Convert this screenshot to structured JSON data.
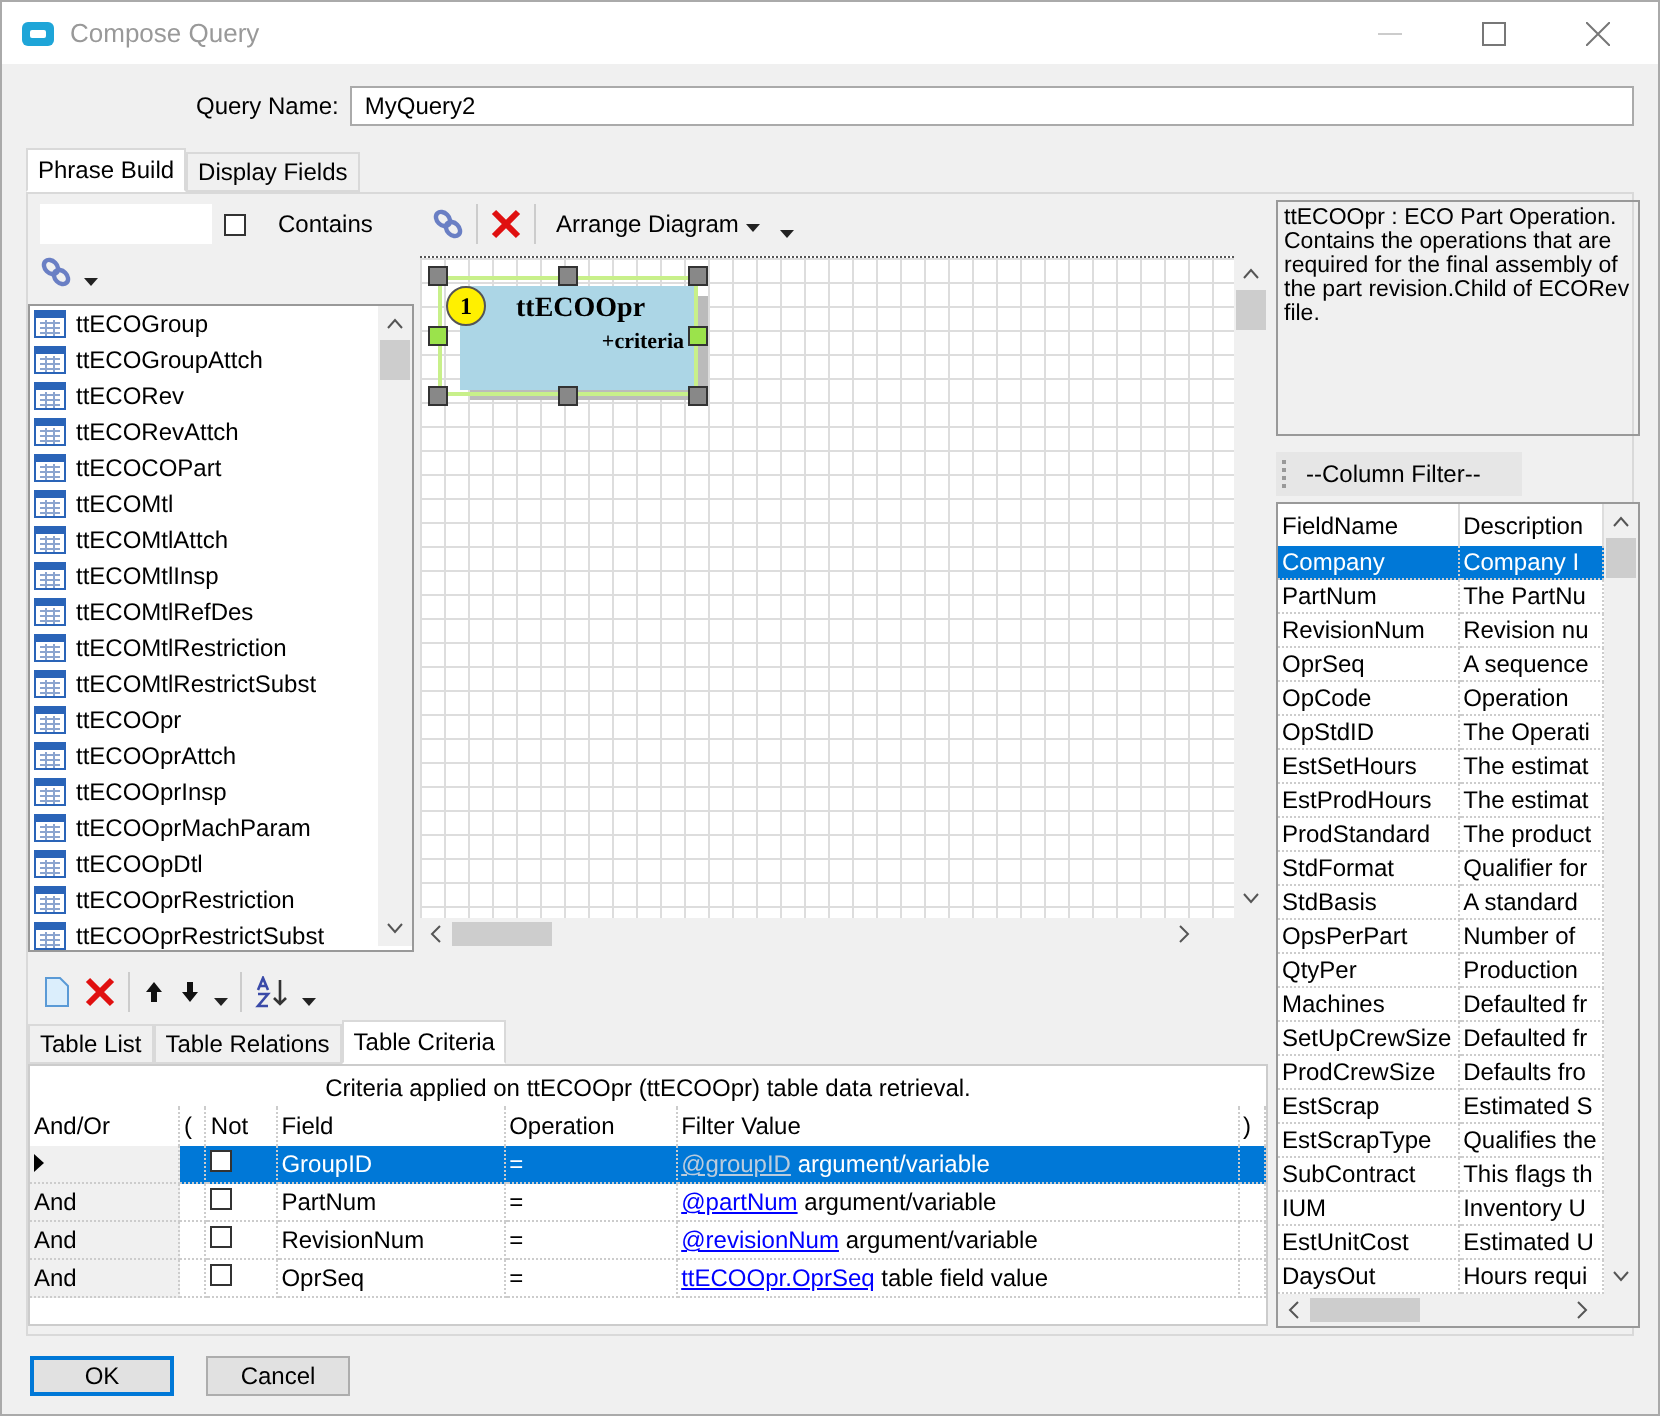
{
  "window": {
    "title": "Compose Query"
  },
  "query_name": {
    "label": "Query Name:",
    "value": "MyQuery2"
  },
  "tabs": [
    {
      "label": "Phrase Build",
      "selected": true
    },
    {
      "label": "Display Fields",
      "selected": false
    }
  ],
  "table_search": {
    "checkbox_label": "Contains",
    "checked": false
  },
  "tables": [
    "ttECOGroup",
    "ttECOGroupAttch",
    "ttECORev",
    "ttECORevAttch",
    "ttECOCOPart",
    "ttECOMtl",
    "ttECOMtlAttch",
    "ttECOMtlInsp",
    "ttECOMtlRefDes",
    "ttECOMtlRestriction",
    "ttECOMtlRestrictSubst",
    "ttECOOpr",
    "ttECOOprAttch",
    "ttECOOprInsp",
    "ttECOOprMachParam",
    "ttECOOpDtl",
    "ttECOOprRestriction",
    "ttECOOprRestrictSubst"
  ],
  "diagram_toolbar": {
    "arrange_label": "Arrange Diagram"
  },
  "diagram": {
    "nodes": [
      {
        "number": "1",
        "title": "ttECOOpr",
        "subtitle": "+criteria",
        "selected": true
      }
    ]
  },
  "description": "ttECOOpr : ECO Part Operation. Contains the operations that are required for the final assembly of the part revision.Child of ECORev file.",
  "column_filter": "--Column Filter--",
  "fields": {
    "columns": [
      "FieldName",
      "Description"
    ],
    "rows": [
      {
        "name": "Company",
        "description": "Company I",
        "selected": true
      },
      {
        "name": "PartNum",
        "description": "The PartNu",
        "selected": false
      },
      {
        "name": "RevisionNum",
        "description": "Revision nu",
        "selected": false
      },
      {
        "name": "OprSeq",
        "description": "A sequence",
        "selected": false
      },
      {
        "name": "OpCode",
        "description": "Operation",
        "selected": false
      },
      {
        "name": "OpStdID",
        "description": "The Operati",
        "selected": false
      },
      {
        "name": "EstSetHours",
        "description": "The estimat",
        "selected": false
      },
      {
        "name": "EstProdHours",
        "description": "The estimat",
        "selected": false
      },
      {
        "name": "ProdStandard",
        "description": "The product",
        "selected": false
      },
      {
        "name": "StdFormat",
        "description": "Qualifier for",
        "selected": false
      },
      {
        "name": "StdBasis",
        "description": "A standard",
        "selected": false
      },
      {
        "name": "OpsPerPart",
        "description": "Number of",
        "selected": false
      },
      {
        "name": "QtyPer",
        "description": "Production",
        "selected": false
      },
      {
        "name": "Machines",
        "description": "Defaulted fr",
        "selected": false
      },
      {
        "name": "SetUpCrewSize",
        "description": "Defaulted fr",
        "selected": false
      },
      {
        "name": "ProdCrewSize",
        "description": "Defaults fro",
        "selected": false
      },
      {
        "name": "EstScrap",
        "description": "Estimated S",
        "selected": false
      },
      {
        "name": "EstScrapType",
        "description": "Qualifies the",
        "selected": false
      },
      {
        "name": "SubContract",
        "description": "This flags th",
        "selected": false
      },
      {
        "name": "IUM",
        "description": "Inventory U",
        "selected": false
      },
      {
        "name": "EstUnitCost",
        "description": "Estimated U",
        "selected": false
      },
      {
        "name": "DaysOut",
        "description": "Hours requi",
        "selected": false
      }
    ]
  },
  "bottom_tabs": [
    {
      "label": "Table List",
      "selected": false
    },
    {
      "label": "Table Relations",
      "selected": false
    },
    {
      "label": "Table Criteria",
      "selected": true
    }
  ],
  "criteria": {
    "caption": "Criteria applied on ttECOOpr (ttECOOpr)  table data retrieval.",
    "columns": [
      "And/Or",
      "(",
      "Not",
      "Field",
      "Operation",
      "Filter Value",
      ")"
    ],
    "rows": [
      {
        "and_or": "",
        "not": false,
        "field": "GroupID",
        "operation": "=",
        "value_link": "@groupID",
        "value_kind": "argument/variable",
        "selected": true
      },
      {
        "and_or": "And",
        "not": false,
        "field": "PartNum",
        "operation": "=",
        "value_link": "@partNum",
        "value_kind": "argument/variable",
        "selected": false
      },
      {
        "and_or": "And",
        "not": false,
        "field": "RevisionNum",
        "operation": "=",
        "value_link": "@revisionNum",
        "value_kind": "argument/variable",
        "selected": false
      },
      {
        "and_or": "And",
        "not": false,
        "field": "OprSeq",
        "operation": "=",
        "value_link": "ttECOOpr.OprSeq",
        "value_kind": "table field value",
        "selected": false
      }
    ]
  },
  "buttons": [
    {
      "label": "OK",
      "default": true
    },
    {
      "label": "Cancel",
      "default": false
    }
  ]
}
